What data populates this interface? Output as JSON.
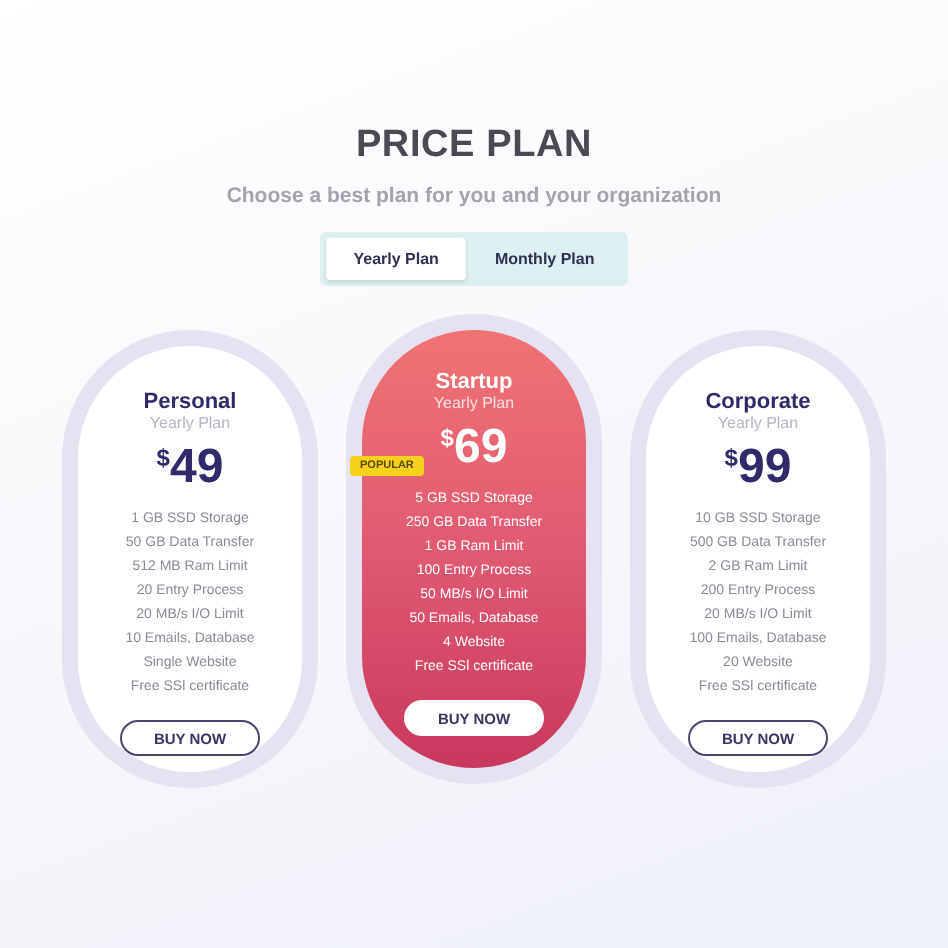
{
  "title": "PRICE PLAN",
  "subtitle": "Choose a best plan for you and your organization",
  "tabs": [
    {
      "label": "Yearly Plan",
      "selected": true
    },
    {
      "label": "Monthly Plan",
      "selected": false
    }
  ],
  "plans": [
    {
      "name": "Personal",
      "period": "Yearly Plan",
      "currency": "$",
      "amount": "49",
      "featured": false,
      "features": [
        "1 GB SSD Storage",
        "50 GB Data Transfer",
        "512 MB Ram Limit",
        "20 Entry Process",
        "20 MB/s I/O Limit",
        "10 Emails, Database",
        "Single Website",
        "Free SSl certificate"
      ],
      "button": "BUY NOW"
    },
    {
      "name": "Startup",
      "period": "Yearly Plan",
      "currency": "$",
      "amount": "69",
      "featured": true,
      "badge": "POPULAR",
      "features": [
        "5 GB SSD Storage",
        "250 GB Data Transfer",
        "1 GB Ram Limit",
        "100 Entry Process",
        "50 MB/s I/O Limit",
        "50 Emails, Database",
        "4 Website",
        "Free SSl certificate"
      ],
      "button": "BUY NOW"
    },
    {
      "name": "Corporate",
      "period": "Yearly Plan",
      "currency": "$",
      "amount": "99",
      "featured": false,
      "features": [
        "10 GB SSD Storage",
        "500 GB Data Transfer",
        "2 GB Ram Limit",
        "200 Entry Process",
        "20 MB/s I/O Limit",
        "100 Emails, Database",
        "20 Website",
        "Free SSl certificate"
      ],
      "button": "BUY NOW"
    }
  ]
}
